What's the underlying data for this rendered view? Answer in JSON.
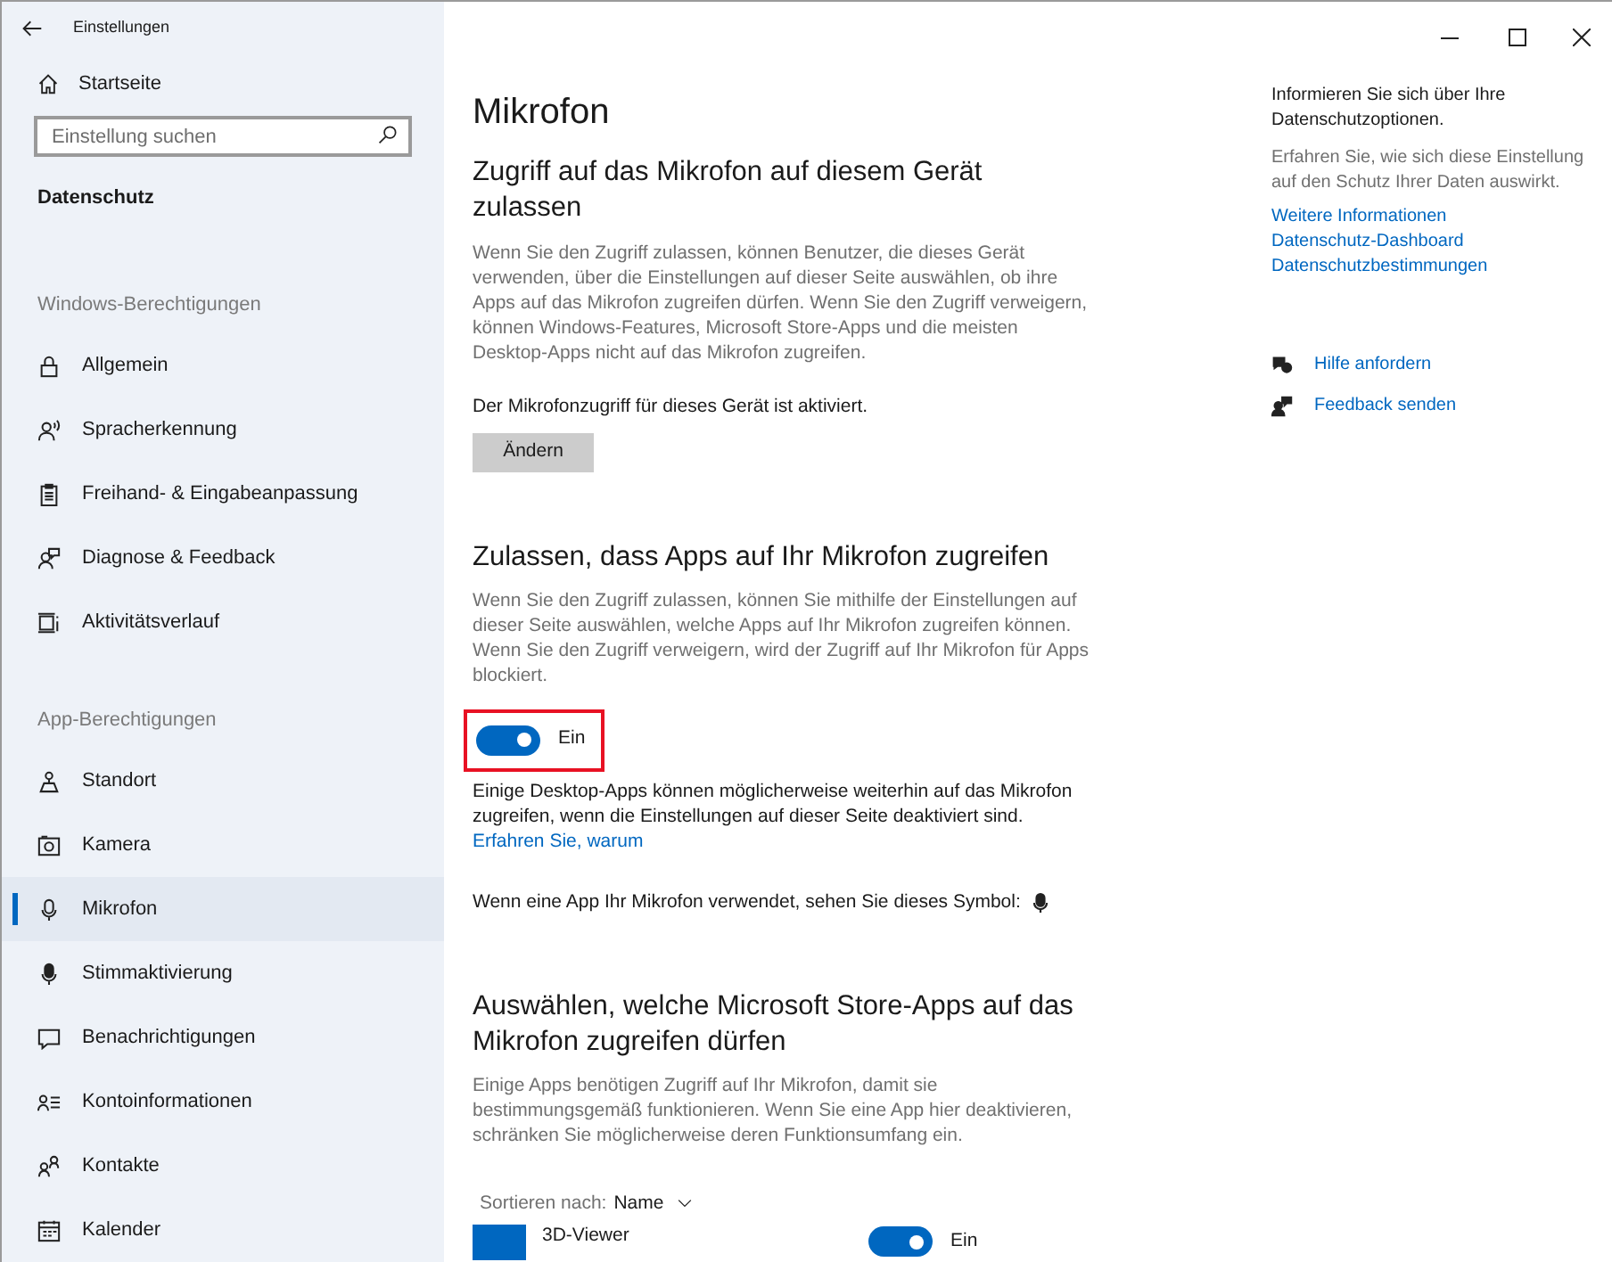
{
  "window": {
    "title": "Einstellungen"
  },
  "sidebar": {
    "home": "Startseite",
    "search": {
      "placeholder": "Einstellung suchen"
    },
    "category": "Datenschutz",
    "groups": [
      {
        "heading": "Windows-Berechtigungen",
        "items": [
          {
            "label": "Allgemein",
            "selected": false
          },
          {
            "label": "Spracherkennung",
            "selected": false
          },
          {
            "label": "Freihand- & Eingabeanpassung",
            "selected": false
          },
          {
            "label": "Diagnose & Feedback",
            "selected": false
          },
          {
            "label": "Aktivitätsverlauf",
            "selected": false
          }
        ]
      },
      {
        "heading": "App-Berechtigungen",
        "items": [
          {
            "label": "Standort",
            "selected": false
          },
          {
            "label": "Kamera",
            "selected": false
          },
          {
            "label": "Mikrofon",
            "selected": true
          },
          {
            "label": "Stimmaktivierung",
            "selected": false
          },
          {
            "label": "Benachrichtigungen",
            "selected": false
          },
          {
            "label": "Kontoinformationen",
            "selected": false
          },
          {
            "label": "Kontakte",
            "selected": false
          },
          {
            "label": "Kalender",
            "selected": false
          }
        ]
      }
    ]
  },
  "main": {
    "title": "Mikrofon",
    "device_access": {
      "heading": "Zugriff auf das Mikrofon auf diesem Gerät zulassen",
      "description": "Wenn Sie den Zugriff zulassen, können Benutzer, die dieses Gerät verwenden, über die Einstellungen auf dieser Seite auswählen, ob ihre Apps auf das Mikrofon zugreifen dürfen. Wenn Sie den Zugriff verweigern, können Windows-Features, Microsoft Store-Apps und die meisten Desktop-Apps nicht auf das Mikrofon zugreifen.",
      "status": "Der Mikrofonzugriff für dieses Gerät ist aktiviert.",
      "button": "Ändern"
    },
    "app_access": {
      "heading": "Zulassen, dass Apps auf Ihr Mikrofon zugreifen",
      "description": "Wenn Sie den Zugriff zulassen, können Sie mithilfe der Einstellungen auf dieser Seite auswählen, welche Apps auf Ihr Mikrofon zugreifen können. Wenn Sie den Zugriff verweigern, wird der Zugriff auf Ihr Mikrofon für Apps blockiert.",
      "toggle": {
        "on": true,
        "label": "Ein",
        "highlighted": true
      },
      "note": "Einige Desktop-Apps können möglicherweise weiterhin auf das Mikrofon zugreifen, wenn die Einstellungen auf dieser Seite deaktiviert sind.",
      "note_link": "Erfahren Sie, warum",
      "symbol_text": "Wenn eine App Ihr Mikrofon verwendet, sehen Sie dieses Symbol:"
    },
    "store_apps": {
      "heading": "Auswählen, welche Microsoft Store-Apps auf das Mikrofon zugreifen dürfen",
      "description": "Einige Apps benötigen Zugriff auf Ihr Mikrofon, damit sie bestimmungsgemäß funktionieren. Wenn Sie eine App hier deaktivieren, schränken Sie möglicherweise deren Funktionsumfang ein.",
      "sort_label": "Sortieren nach:",
      "sort_value": "Name",
      "apps": [
        {
          "name": "3D-Viewer",
          "on": true,
          "toggle_label": "Ein"
        }
      ]
    }
  },
  "aside": {
    "heading": "Informieren Sie sich über Ihre Datenschutzoptionen.",
    "description": "Erfahren Sie, wie sich diese Einstellung auf den Schutz Ihrer Daten auswirkt.",
    "links": [
      "Weitere Informationen",
      "Datenschutz-Dashboard",
      "Datenschutzbestimmungen"
    ],
    "help": [
      {
        "label": "Hilfe anfordern"
      },
      {
        "label": "Feedback senden"
      }
    ]
  }
}
